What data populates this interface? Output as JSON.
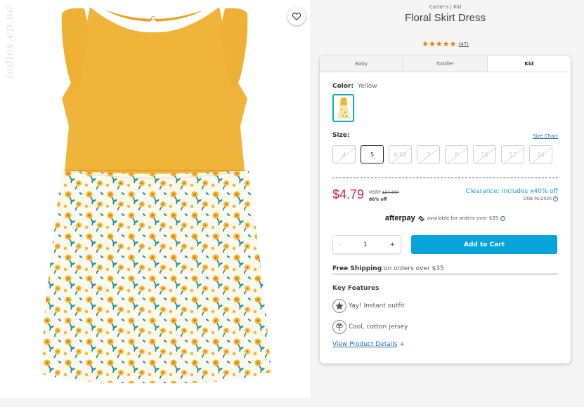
{
  "watermark": "ladies.ep.ua",
  "product": {
    "brand": "Carter's | Kid",
    "title": "Floral Skirt Dress",
    "stars": "★★★★★",
    "review_count": "(47)"
  },
  "tabs": [
    {
      "label": "Baby",
      "active": false
    },
    {
      "label": "Toddler",
      "active": false
    },
    {
      "label": "Kid",
      "active": true
    }
  ],
  "color": {
    "label": "Color:",
    "value": "Yellow"
  },
  "size": {
    "label": "Size:",
    "chart_link": "Size Chart",
    "options": [
      "4",
      "5",
      "6-6X",
      "7",
      "8",
      "10",
      "12",
      "14"
    ],
    "selected": "5"
  },
  "pricing": {
    "price": "$4.79",
    "msrp_label": "MSRP",
    "msrp_value": "$34.00*",
    "discount": "86% off",
    "clearance": "Clearance: Includes x40% off",
    "dob": "DOB 05/2020"
  },
  "afterpay": {
    "logo": "afterpay",
    "text": "available for orders over $35"
  },
  "cart": {
    "quantity": "1",
    "minus": "-",
    "plus": "+",
    "add_label": "Add to Cart"
  },
  "shipping": {
    "bold": "Free Shipping",
    "rest": "on orders over $35"
  },
  "features": {
    "title": "Key Features",
    "items": [
      {
        "text": "Yay! Instant outfit",
        "icon": "star-badge-icon"
      },
      {
        "text": "Cool, cotton jersey",
        "icon": "cotton-icon"
      }
    ],
    "details_link": "View Product Details",
    "details_plus": "+"
  },
  "colors": {
    "accent": "#07a4dc",
    "price": "#d11f4a",
    "clearance": "#10a0c4",
    "stars": "#e07a00",
    "dress_yellow": "#f0b43a"
  }
}
